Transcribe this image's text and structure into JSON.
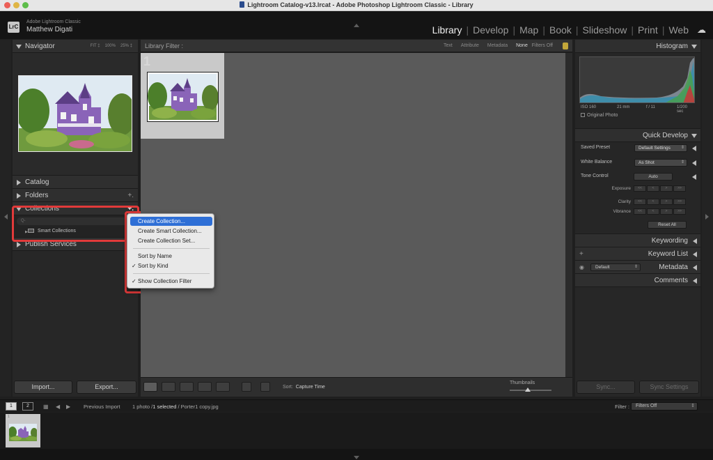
{
  "window": {
    "title": "Lightroom Catalog-v13.lrcat - Adobe Photoshop Lightroom Classic - Library"
  },
  "identity": {
    "badge": "LrC",
    "app_name": "Adobe Lightroom Classic",
    "user": "Matthew Digati"
  },
  "modules": [
    {
      "label": "Library",
      "active": true
    },
    {
      "label": "Develop",
      "active": false
    },
    {
      "label": "Map",
      "active": false
    },
    {
      "label": "Book",
      "active": false
    },
    {
      "label": "Slideshow",
      "active": false
    },
    {
      "label": "Print",
      "active": false
    },
    {
      "label": "Web",
      "active": false
    }
  ],
  "left_panel": {
    "navigator": {
      "title": "Navigator",
      "zoom_options": [
        "FIT ‡",
        "100%",
        "25% ‡"
      ]
    },
    "catalog": "Catalog",
    "folders": "Folders",
    "collections": {
      "title": "Collections",
      "add": "+.",
      "search_placeholder": "Q-",
      "items": [
        "Smart Collections"
      ]
    },
    "publish": "Publish Services",
    "import_button": "Import...",
    "export_button": "Export..."
  },
  "context_menu": {
    "items": [
      {
        "label": "Create Collection...",
        "highlighted": true,
        "checked": false
      },
      {
        "label": "Create Smart Collection...",
        "highlighted": false,
        "checked": false
      },
      {
        "label": "Create Collection Set...",
        "highlighted": false,
        "checked": false
      },
      {
        "label": "Sort by Name",
        "highlighted": false,
        "checked": false
      },
      {
        "label": "Sort by Kind",
        "highlighted": false,
        "checked": true
      },
      {
        "label": "Show Collection Filter",
        "highlighted": false,
        "checked": true
      }
    ],
    "check_glyph": "✓"
  },
  "filter_bar": {
    "label": "Library Filter :",
    "options": [
      "Text",
      "Attribute",
      "Metadata",
      "None"
    ],
    "active_option": "None",
    "filters_off": "Filters Off"
  },
  "grid": {
    "cell_number": "1"
  },
  "toolbar": {
    "sort_label": "Sort:",
    "sort_value": "Capture Time",
    "thumbnails_label": "Thumbnails"
  },
  "right_panel": {
    "histogram": {
      "title": "Histogram",
      "iso": "ISO 160",
      "focal": "21 mm",
      "aperture": "f / 11",
      "shutter": "1/200 sec",
      "original_photo": "Original Photo"
    },
    "quick_develop": {
      "title": "Quick Develop",
      "saved_preset_label": "Saved Preset",
      "saved_preset_value": "Default Settings",
      "white_balance_label": "White Balance",
      "white_balance_value": "As Shot",
      "tone_control_label": "Tone Control",
      "auto_button": "Auto",
      "exposure_label": "Exposure",
      "clarity_label": "Clarity",
      "vibrance_label": "Vibrance",
      "reset_button": "Reset All"
    },
    "keywording": "Keywording",
    "keyword_list": "Keyword List",
    "keyword_list_add": "+",
    "metadata": "Metadata",
    "metadata_preset": "Default",
    "comments": "Comments",
    "sync_button": "Sync...",
    "sync_settings_button": "Sync Settings"
  },
  "filmstrip_bar": {
    "page1": "1",
    "page2": "2",
    "source": "Previous Import",
    "count_prefix": "1 photo /",
    "selected": "1 selected",
    "filename": "/ Porter1 copy.jpg",
    "filter_label": "Filter :",
    "filter_value": "Filters Off"
  },
  "filmstrip": {
    "cell_number": "1"
  },
  "colors": {
    "accent": "#2e6fd6",
    "annotation": "#e23a3a"
  }
}
